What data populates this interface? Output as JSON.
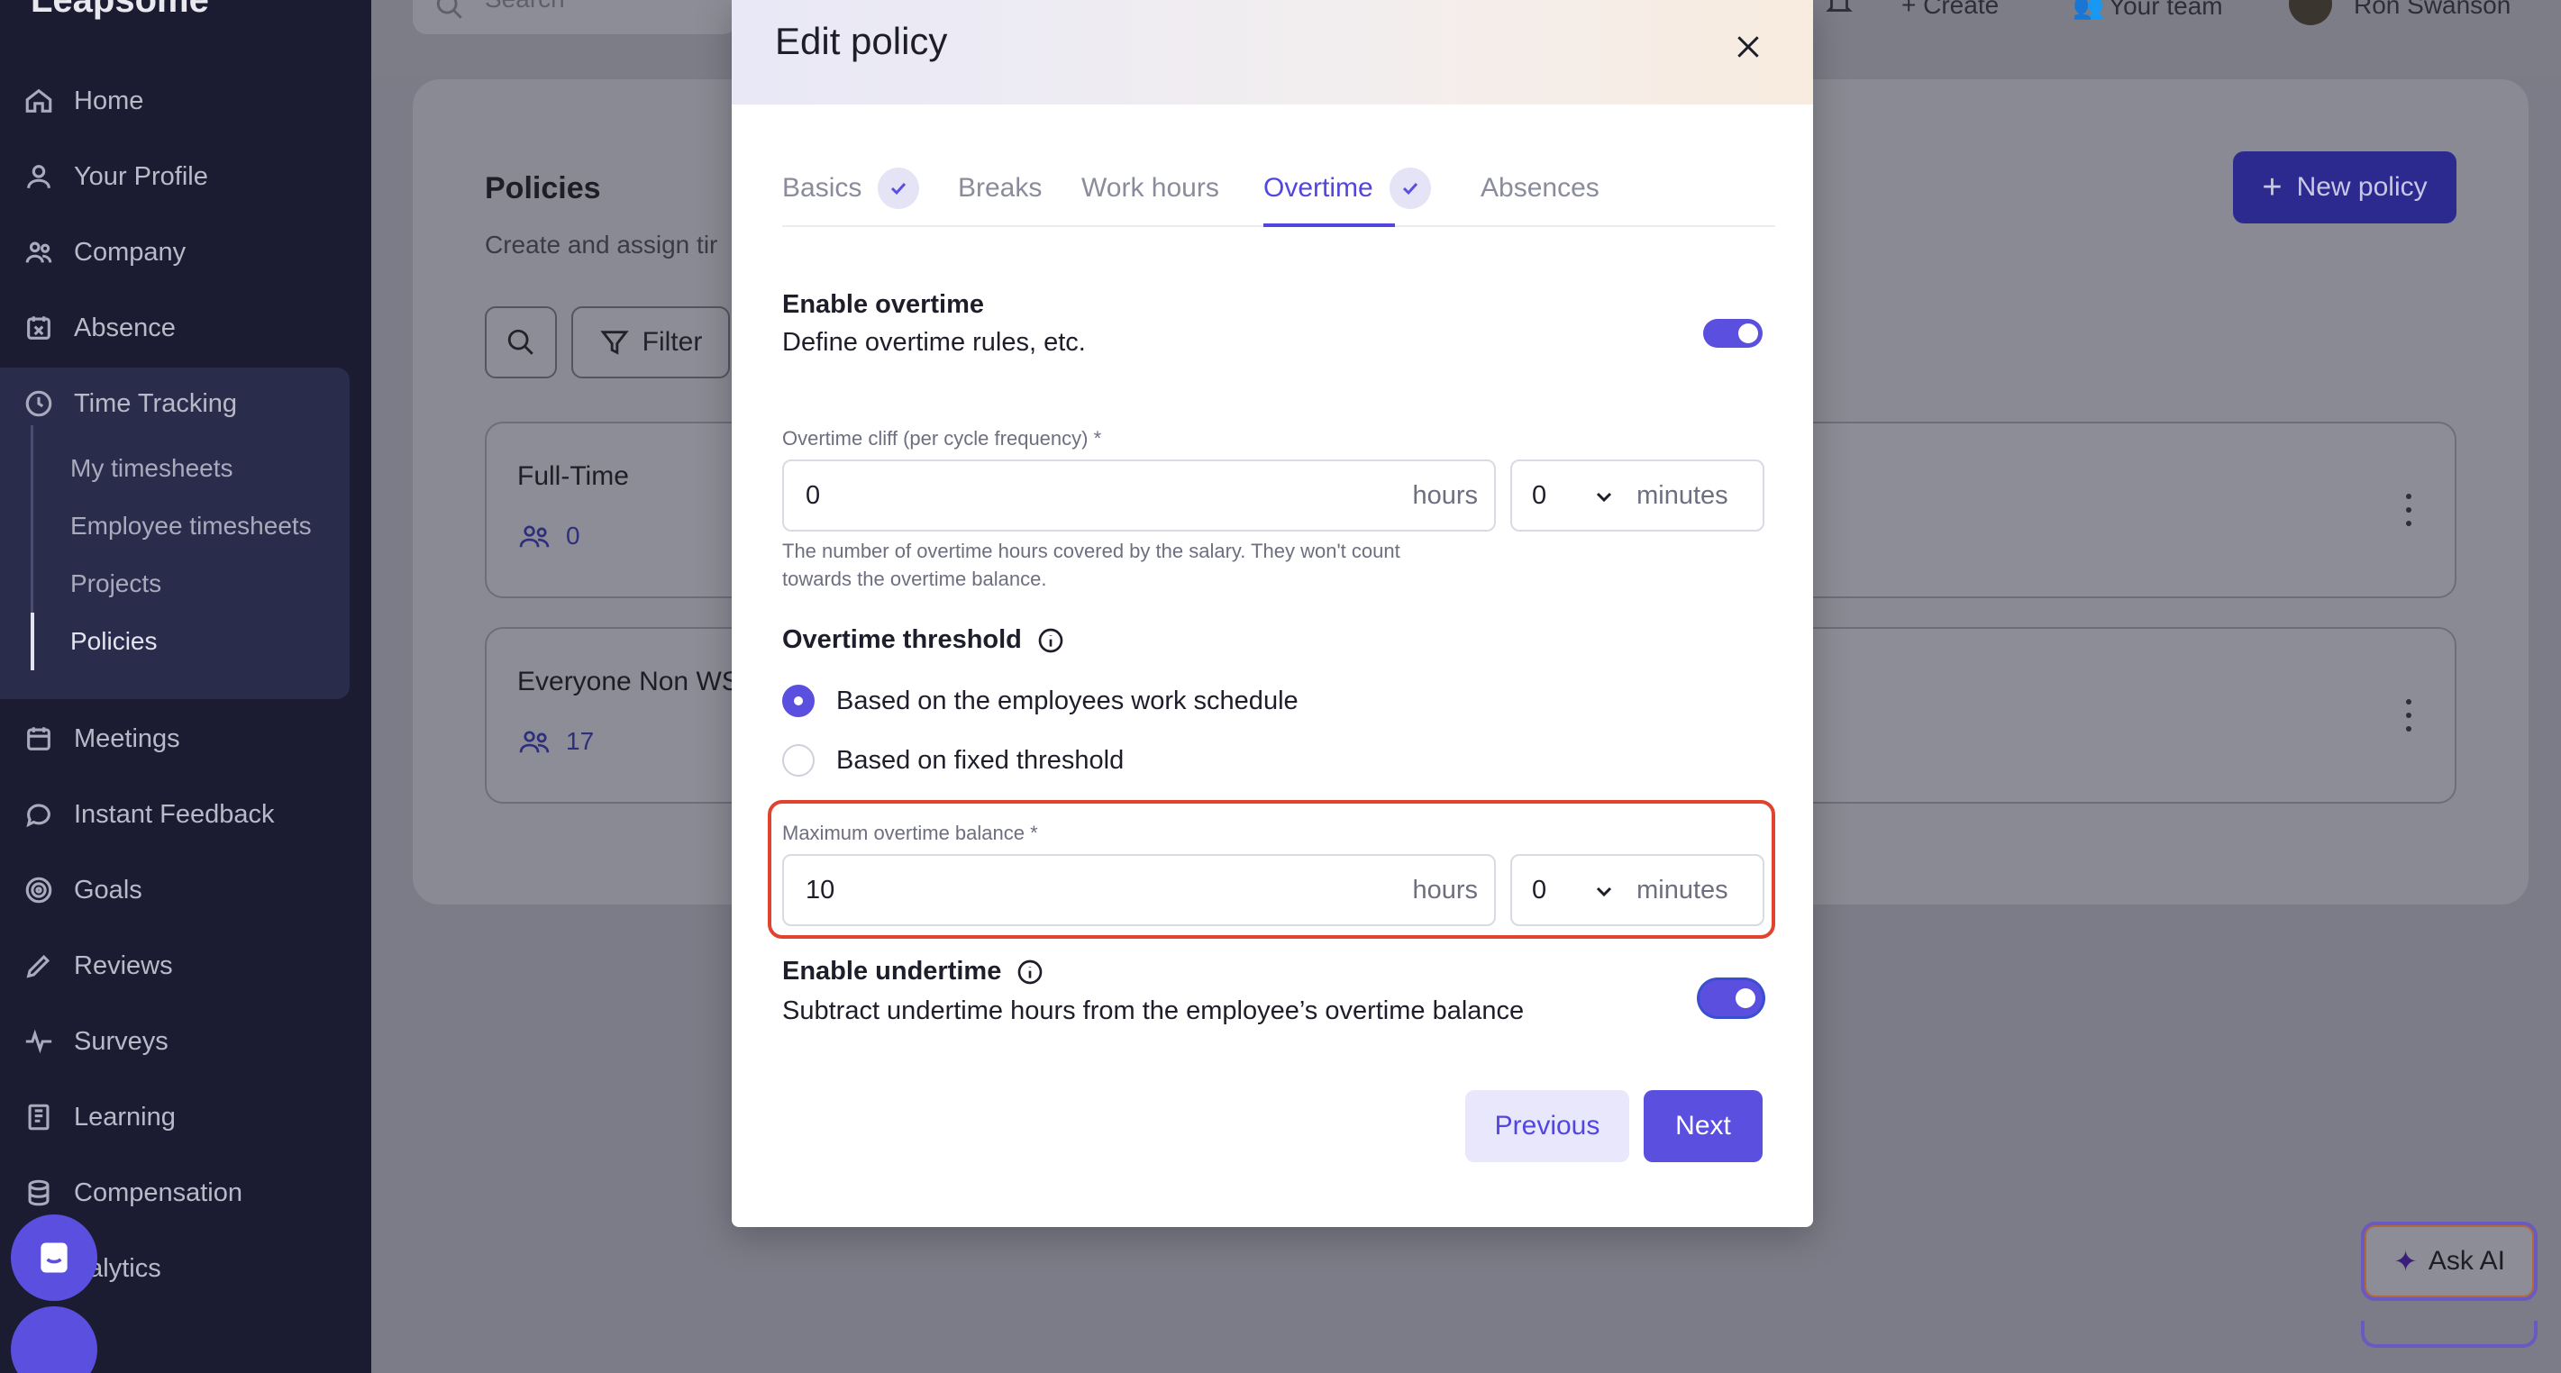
{
  "app": {
    "logo": "Leapsome"
  },
  "sidebar": {
    "items": [
      {
        "label": "Home",
        "icon": "home-icon"
      },
      {
        "label": "Your Profile",
        "icon": "user-icon"
      },
      {
        "label": "Company",
        "icon": "users-icon"
      },
      {
        "label": "Absence",
        "icon": "calendar-x-icon"
      },
      {
        "label": "Time Tracking",
        "icon": "clock-icon"
      },
      {
        "label": "Meetings",
        "icon": "calendar-icon"
      },
      {
        "label": "Instant Feedback",
        "icon": "chat-icon"
      },
      {
        "label": "Goals",
        "icon": "target-icon"
      },
      {
        "label": "Reviews",
        "icon": "pencil-icon"
      },
      {
        "label": "Surveys",
        "icon": "pulse-icon"
      },
      {
        "label": "Learning",
        "icon": "book-icon"
      },
      {
        "label": "Compensation",
        "icon": "coins-icon"
      },
      {
        "label": "nalytics",
        "icon": "chart-icon"
      }
    ],
    "time_tracking_sub": [
      "My timesheets",
      "Employee timesheets",
      "Projects",
      "Policies"
    ]
  },
  "topbar": {
    "search_placeholder": "Search",
    "create": "+ Create",
    "your_team": "Your team",
    "user": "Ron Swanson"
  },
  "page": {
    "title": "Policies",
    "subtitle": "Create and assign tir",
    "filter": "Filter",
    "new_policy": "New policy",
    "policies": [
      {
        "name": "Full-Time",
        "count": "0"
      },
      {
        "name": "Everyone Non WS",
        "count": "17"
      }
    ],
    "ask_ai": "Ask AI"
  },
  "modal": {
    "title": "Edit policy",
    "tabs": [
      {
        "label": "Basics",
        "done": true
      },
      {
        "label": "Breaks",
        "done": false
      },
      {
        "label": "Work hours",
        "done": false
      },
      {
        "label": "Overtime",
        "done": true,
        "active": true
      },
      {
        "label": "Absences",
        "done": false
      }
    ],
    "enable_overtime": {
      "title": "Enable overtime",
      "desc": "Define overtime rules, etc.",
      "on": true
    },
    "overtime_cliff": {
      "label": "Overtime cliff (per cycle frequency) *",
      "hours_value": "0",
      "hours_suffix": "hours",
      "minutes_value": "0",
      "minutes_suffix": "minutes",
      "help_line1": "The number of overtime hours covered by the salary. They won't count",
      "help_line2": "towards the overtime balance."
    },
    "threshold": {
      "title": "Overtime threshold",
      "options": [
        {
          "label": "Based on the employees work schedule",
          "selected": true
        },
        {
          "label": "Based on fixed threshold",
          "selected": false
        }
      ]
    },
    "max_balance": {
      "label": "Maximum overtime balance *",
      "hours_value": "10",
      "hours_suffix": "hours",
      "minutes_value": "0",
      "minutes_suffix": "minutes"
    },
    "undertime": {
      "title": "Enable undertime",
      "desc": "Subtract undertime hours from the employee’s overtime balance",
      "on": true
    },
    "previous": "Previous",
    "next": "Next"
  },
  "colors": {
    "accent": "#5b4fe0",
    "highlight": "#e0432e",
    "sidebar_bg": "#1b1c32"
  }
}
